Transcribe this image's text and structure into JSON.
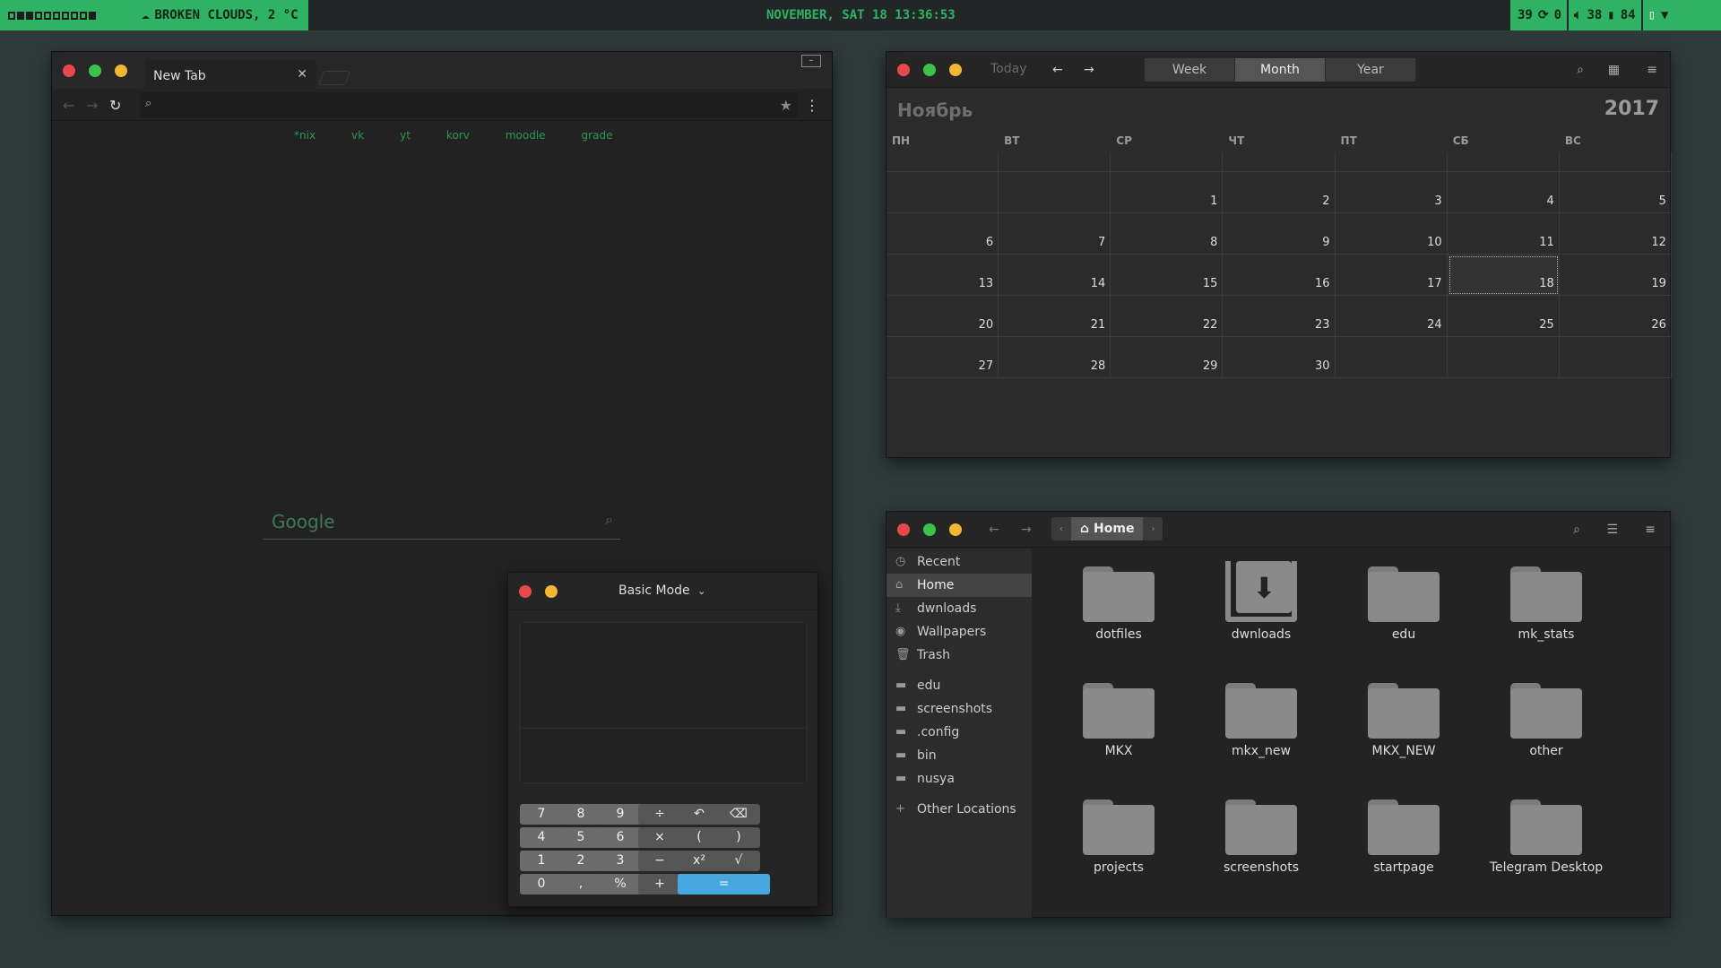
{
  "topbar": {
    "workspaces": [
      false,
      true,
      true,
      false,
      false,
      false,
      false,
      false,
      false,
      true
    ],
    "weather": "BROKEN CLOUDS, 2 °C",
    "clock": "NOVEMBER, SAT 18 13:36:53",
    "tray": {
      "a": "39",
      "b": "0",
      "volume": "38",
      "battery": "84"
    }
  },
  "browser": {
    "tab_title": "New Tab",
    "bookmarks": [
      "*nix",
      "vk",
      "yt",
      "korv",
      "moodle",
      "grade"
    ],
    "search_placeholder": "Google"
  },
  "calculator": {
    "mode": "Basic Mode",
    "keys": [
      [
        "7",
        "8",
        "9",
        "÷",
        "↶",
        "⌫"
      ],
      [
        "4",
        "5",
        "6",
        "×",
        "(",
        ")"
      ],
      [
        "1",
        "2",
        "3",
        "−",
        "x²",
        "√"
      ],
      [
        "0",
        ",",
        "%",
        "+",
        "="
      ]
    ]
  },
  "calendar": {
    "today_label": "Today",
    "views": [
      "Week",
      "Month",
      "Year"
    ],
    "active_view": "Month",
    "month": "Ноябрь",
    "year": "2017",
    "weekdays": [
      "ПН",
      "ВТ",
      "СР",
      "ЧТ",
      "ПТ",
      "СБ",
      "ВС"
    ],
    "weeks": [
      [
        "",
        "",
        "",
        "",
        "",
        "",
        ""
      ],
      [
        "",
        "",
        "1",
        "2",
        "3",
        "4",
        "5"
      ],
      [
        "6",
        "7",
        "8",
        "9",
        "10",
        "11",
        "12"
      ],
      [
        "13",
        "14",
        "15",
        "16",
        "17",
        "18",
        "19"
      ],
      [
        "20",
        "21",
        "22",
        "23",
        "24",
        "25",
        "26"
      ],
      [
        "27",
        "28",
        "29",
        "30",
        "",
        "",
        ""
      ]
    ],
    "today": "18"
  },
  "files": {
    "location": "Home",
    "sidebar": [
      {
        "label": "Recent",
        "icon": "clock-icon"
      },
      {
        "label": "Home",
        "icon": "home-icon",
        "active": true
      },
      {
        "label": "dwnloads",
        "icon": "download-icon"
      },
      {
        "label": "Wallpapers",
        "icon": "camera-icon"
      },
      {
        "label": "Trash",
        "icon": "trash-icon"
      },
      {
        "label": "edu",
        "icon": "folder-icon"
      },
      {
        "label": "screenshots",
        "icon": "folder-icon"
      },
      {
        "label": ".config",
        "icon": "folder-icon"
      },
      {
        "label": "bin",
        "icon": "folder-icon"
      },
      {
        "label": "nusya",
        "icon": "folder-icon"
      },
      {
        "label": "Other Locations",
        "icon": "plus-icon"
      }
    ],
    "items": [
      "dotfiles",
      "dwnloads",
      "edu",
      "mk_stats",
      "MKX",
      "mkx_new",
      "MKX_NEW",
      "other",
      "projects",
      "screenshots",
      "startpage",
      "Telegram Desktop"
    ]
  }
}
